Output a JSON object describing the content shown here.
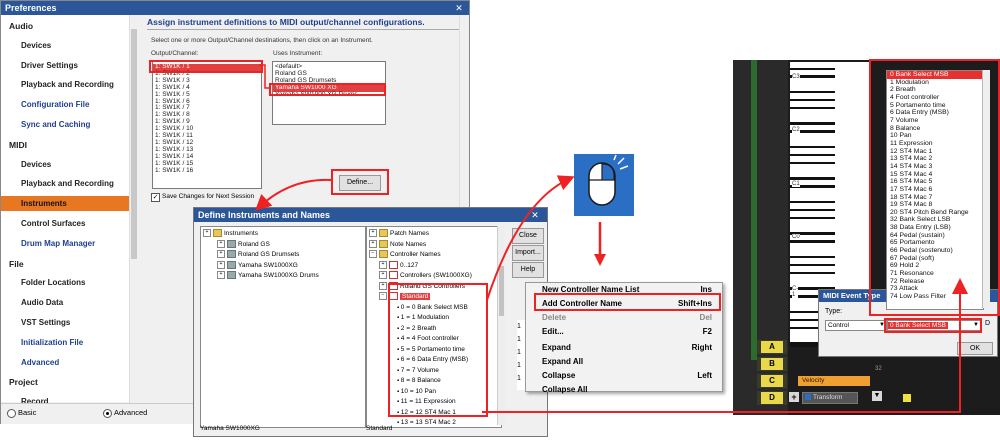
{
  "prefs": {
    "title": "Preferences",
    "close_glyph": "✕",
    "nav": [
      {
        "label": "Audio",
        "kind": "head"
      },
      {
        "label": "Devices",
        "kind": "item"
      },
      {
        "label": "Driver Settings",
        "kind": "item"
      },
      {
        "label": "Playback and Recording",
        "kind": "item"
      },
      {
        "label": "Configuration File",
        "kind": "link"
      },
      {
        "label": "Sync and Caching",
        "kind": "link"
      },
      {
        "label": "MIDI",
        "kind": "head"
      },
      {
        "label": "Devices",
        "kind": "item"
      },
      {
        "label": "Playback and Recording",
        "kind": "item"
      },
      {
        "label": "Instruments",
        "kind": "selected"
      },
      {
        "label": "Control Surfaces",
        "kind": "item"
      },
      {
        "label": "Drum Map Manager",
        "kind": "link"
      },
      {
        "label": "File",
        "kind": "head"
      },
      {
        "label": "Folder Locations",
        "kind": "item"
      },
      {
        "label": "Audio Data",
        "kind": "item"
      },
      {
        "label": "VST Settings",
        "kind": "item"
      },
      {
        "label": "Initialization File",
        "kind": "link"
      },
      {
        "label": "Advanced",
        "kind": "link"
      },
      {
        "label": "Project",
        "kind": "head"
      },
      {
        "label": "Record",
        "kind": "item"
      }
    ],
    "mode_basic": "Basic",
    "mode_advanced": "Advanced",
    "panel_heading": "Assign instrument definitions to MIDI output/channel configurations.",
    "instructions": "Select one or more Output/Channel destinations, then click on an Instrument.",
    "output_label": "Output/Channel:",
    "uses_label": "Uses Instrument:",
    "outputs": [
      "1: SW1K / 1",
      "1: SW1K / 2",
      "1: SW1K / 3",
      "1: SW1K / 4",
      "1: SW1K / 5",
      "1: SW1K / 6",
      "1: SW1K / 7",
      "1: SW1K / 8",
      "1: SW1K / 9",
      "1: SW1K / 10",
      "1: SW1K / 11",
      "1: SW1K / 12",
      "1: SW1K / 13",
      "1: SW1K / 14",
      "1: SW1K / 15",
      "1: SW1K / 16"
    ],
    "instruments": [
      "<default>",
      "Roland GS",
      "Roland GS Drumsets",
      "Yamaha SW1000 XG",
      "Yamaha SW1000 XG Drums"
    ],
    "define_button": "Define...",
    "save_changes": "Save Changes for Next Session"
  },
  "define": {
    "title": "Define Instruments and Names",
    "close_glyph": "✕",
    "left_tree": [
      {
        "label": "Instruments",
        "level": 0
      },
      {
        "label": "Roland GS",
        "level": 1
      },
      {
        "label": "Roland GS Drumsets",
        "level": 1
      },
      {
        "label": "Yamaha SW1000XG",
        "level": 1
      },
      {
        "label": "Yamaha SW1000XG Drums",
        "level": 1
      }
    ],
    "right_tree": [
      {
        "label": "Patch Names",
        "level": 0
      },
      {
        "label": "Note Names",
        "level": 0
      },
      {
        "label": "Controller Names",
        "level": 0
      },
      {
        "label": "0..127",
        "level": 1
      },
      {
        "label": "Controllers (SW1000XG)",
        "level": 1
      },
      {
        "label": "Roland GS Controllers",
        "level": 1
      },
      {
        "label": "Standard",
        "level": 1
      }
    ],
    "standard_items": [
      "0 = 0 Bank Select MSB",
      "1 = 1 Modulation",
      "2 = 2 Breath",
      "4 = 4 Foot controller",
      "5 = 5 Portamento time",
      "6 = 6 Data Entry (MSB)",
      "7 = 7 Volume",
      "8 = 8 Balance",
      "10 = 10 Pan",
      "11 = 11 Expression",
      "12 = 12 ST4 Mac 1",
      "13 = 13 ST4 Mac 2",
      "14 = 14 ST4 Mac 3"
    ],
    "btn_close": "Close",
    "btn_import": "Import...",
    "btn_help": "Help",
    "status_left": "Yamaha SW1000XG",
    "status_right": "Standard"
  },
  "context_menu": {
    "items": [
      {
        "label": "New Controller Name List",
        "shortcut": "Ins",
        "disabled": false,
        "highlight": false
      },
      {
        "label": "Add Controller  Name",
        "shortcut": "Shift+Ins",
        "disabled": false,
        "highlight": true
      },
      {
        "label": "Delete",
        "shortcut": "Del",
        "disabled": true,
        "highlight": false
      },
      {
        "label": "Edit...",
        "shortcut": "F2",
        "disabled": false,
        "highlight": false
      },
      {
        "label": "Expand",
        "shortcut": "Right",
        "disabled": false,
        "highlight": false
      },
      {
        "label": "Expand All",
        "shortcut": "",
        "disabled": false,
        "highlight": false
      },
      {
        "label": "Collapse",
        "shortcut": "Left",
        "disabled": false,
        "highlight": false
      },
      {
        "label": "Collapse All",
        "shortcut": "",
        "disabled": false,
        "highlight": false
      }
    ],
    "partial_digits": [
      "1",
      "1",
      "1",
      "1",
      "1"
    ]
  },
  "mouse_icon": "mouse-right-click-icon",
  "piano": {
    "octave_labels": [
      "C3",
      "C2",
      "C1",
      "C0",
      "C-1"
    ],
    "tracks": [
      "A",
      "B",
      "C",
      "D"
    ],
    "velocity_label": "Velocity",
    "transform_label": "Transform",
    "ruler_value": "32"
  },
  "midi_event": {
    "title": "MIDI Event Type",
    "type_label": "Type:",
    "type_value": "Control",
    "controller_value": "0 Bank Select MSB",
    "ok": "OK",
    "partial_letter": "D"
  },
  "controllers": [
    "0 Bank Select MSB",
    "1 Modulation",
    "2 Breath",
    "4 Foot controller",
    "5 Portamento time",
    "6 Data Entry (MSB)",
    "7 Volume",
    "8 Balance",
    "10 Pan",
    "11 Expression",
    "12 ST4 Mac 1",
    "13 ST4 Mac 2",
    "14 ST4 Mac 3",
    "15 ST4 Mac 4",
    "16 ST4 Mac 5",
    "17 ST4 Mac 6",
    "18 ST4 Mac 7",
    "19 ST4 Mac 8",
    "20 ST4 Pitch Bend Range",
    "32 Bank Select LSB",
    "38 Data Entry (LSB)",
    "64 Pedal (sustain)",
    "65 Portamento",
    "66 Pedal (sostenuto)",
    "67 Pedal (soft)",
    "69 Hold 2",
    "71 Resonance",
    "72 Release",
    "73 Attack",
    "74 Low Pass Filter"
  ],
  "colors": {
    "accent_red": "#e22222",
    "title_blue": "#2b579a",
    "selected_nav": "#e87722",
    "track_yellow": "#e8d84a",
    "velocity_orange": "#f0a030",
    "mouse_tile": "#2a6fc4"
  }
}
